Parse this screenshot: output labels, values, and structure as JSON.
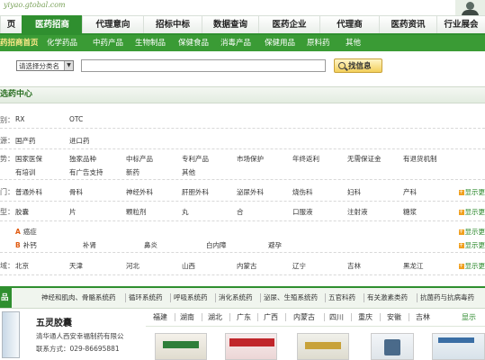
{
  "header": {
    "site_url": "yiyao.gtobal.com"
  },
  "main_nav": [
    {
      "label": "页"
    },
    {
      "label": "医药招商"
    },
    {
      "label": "代理意向"
    },
    {
      "label": "招标中标"
    },
    {
      "label": "数据查询"
    },
    {
      "label": "医药企业"
    },
    {
      "label": "代理商"
    },
    {
      "label": "医药资讯"
    },
    {
      "label": "行业展会"
    }
  ],
  "sub_nav": [
    {
      "label": "药招商首页"
    },
    {
      "label": "化学药品"
    },
    {
      "label": "中药产品"
    },
    {
      "label": "生物制品"
    },
    {
      "label": "保健食品"
    },
    {
      "label": "消毒产品"
    },
    {
      "label": "保健用品"
    },
    {
      "label": "原料药"
    },
    {
      "label": "其他"
    }
  ],
  "search": {
    "category_value": "请选择分类名",
    "input_value": "",
    "button_label": "找信息"
  },
  "section": {
    "title": "选药中心"
  },
  "filters": [
    {
      "label": "别：",
      "values": [
        "RX",
        "OTC"
      ],
      "more": ""
    },
    {
      "label": "源：",
      "values": [
        "国产药",
        "进口药"
      ],
      "more": ""
    },
    {
      "label": "势：",
      "values": [
        "国家医保",
        "独家品种",
        "中标产品",
        "专利产品",
        "市场保护",
        "年终返利",
        "无需保证金",
        "有退货机制",
        "有培训",
        "有广告支持",
        "新药",
        "其他"
      ],
      "more": ""
    },
    {
      "label": "门：",
      "values": [
        "普通外科",
        "骨科",
        "神经外科",
        "肝胆外科",
        "泌尿外科",
        "烧伤科",
        "妇科",
        "产科"
      ],
      "more": "显示更"
    },
    {
      "label": "型：",
      "values": [
        "胶囊",
        "片",
        "颗粒剂",
        "丸",
        "合",
        "口服液",
        "注射液",
        "糖浆"
      ],
      "more": "显示更"
    },
    {
      "label": "",
      "values": [
        "癌症",
        "补钙",
        "补肾",
        "鼻炎",
        "白内障",
        "避孕"
      ],
      "letters": [
        "A",
        "B"
      ],
      "more": "显示更"
    },
    {
      "label": "域：",
      "values": [
        "北京",
        "天津",
        "河北",
        "山西",
        "内蒙古",
        "辽宁",
        "吉林",
        "黑龙江"
      ],
      "more": "显示更"
    }
  ],
  "product_tabs": {
    "label": "品",
    "items": [
      "神经和肌肉、骨骼系统药",
      "循环系统药",
      "呼吸系统药",
      "消化系统药",
      "泌尿、生殖系统药",
      "五官科药",
      "有关激素类药",
      "抗菌药与抗病毒药"
    ]
  },
  "featured": {
    "name": "五灵胶囊",
    "company": "清华通人西安幸福制药有限公",
    "contact": "联系方式：029-86695881"
  },
  "regions": {
    "items": [
      "福建",
      "湖南",
      "湖北",
      "广东",
      "广西",
      "内蒙古",
      "四川",
      "重庆",
      "安徽",
      "吉林"
    ],
    "more": "显示"
  },
  "colors": {
    "brand_green": "#2f8f2f",
    "subnav_green": "#3a9b35",
    "more_link": "#2d8a2d",
    "letter_orange": "#e05a10"
  }
}
